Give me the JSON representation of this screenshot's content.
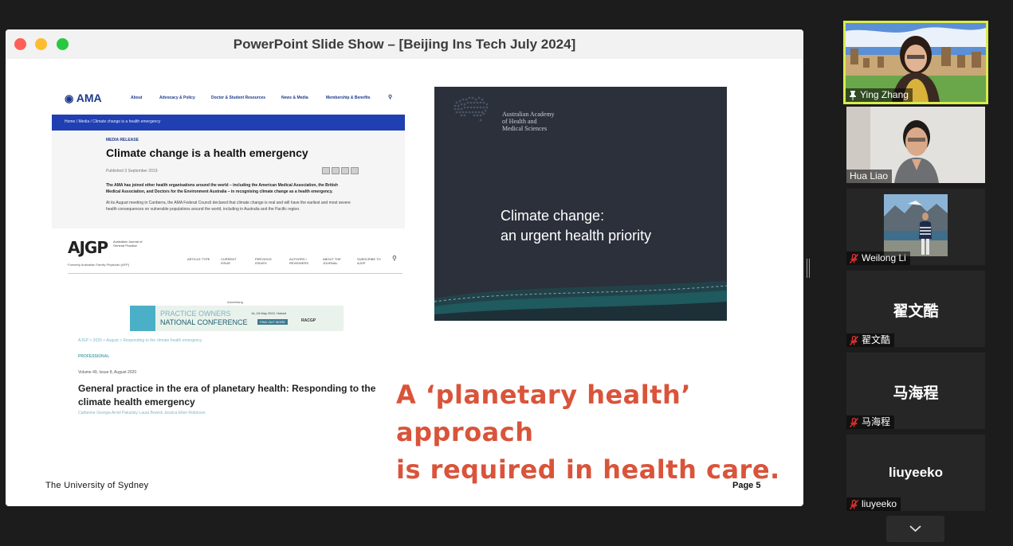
{
  "window": {
    "title": "PowerPoint Slide Show – [Beijing Ins Tech July 2024]",
    "traffic_colors": [
      "#fe5f57",
      "#febc2e",
      "#28c840"
    ]
  },
  "ama": {
    "logo": "AMA",
    "nav": [
      "About",
      "Advocacy & Policy",
      "Doctor & Student Resources",
      "News & Media",
      "Membership & Benefits"
    ],
    "breadcrumb": "Home  /  Media  /  Climate change is a health emergency",
    "label": "MEDIA RELEASE",
    "title": "Climate change is a health emergency",
    "date": "Published 3 September 2019",
    "body1": "The AMA has joined other health organisations around the world – including the American Medical Association, the British Medical Association, and Doctors for the Environment Australia – in recognising climate change as a health emergency.",
    "body2": "At its August meeting in Canberra, the AMA Federal Council declared that climate change is real and will have the earliest and most severe health consequences on vulnerable populations around the world, including in Australia and the Pacific region."
  },
  "ajgp": {
    "logo": "AJGP",
    "subtitle": "Australian Journal of General Practice",
    "formerly": "Formerly Australian Family Physician (AFP)",
    "nav": [
      "ARTICLE TYPE",
      "CURRENT ISSUE",
      "PREVIOUS ISSUES",
      "AUTHORS / REVIEWERS",
      "ABOUT THE JOURNAL",
      "SUBSCRIBE TO AJGP"
    ],
    "ad_label": "Advertising",
    "ad_line1": "PRACTICE OWNERS",
    "ad_line2": "NATIONAL CONFERENCE",
    "ad_date": "14–15 May 2022, Hobart",
    "ad_button": "FIND OUT MORE",
    "ad_brand": "RACGP",
    "breadcrumb": "AJGP > 2020 > August > Responding to the climate health emergency",
    "type": "PROFESSIONAL",
    "volume": "Volume 49, Issue 8, August 2020",
    "title": "General practice in the era of planetary health: Responding to the climate health emergency",
    "authors": "Catherine Georgia Arriol Pakulsky    Laura Bowick    Jessica Ellen Robinson"
  },
  "dark_slide": {
    "org": [
      "Australian Academy",
      "of Health and",
      "Medical Sciences"
    ],
    "title_line1": "Climate change:",
    "title_line2": "an urgent health priority"
  },
  "tagline": {
    "line1": "A ‘planetary health’ approach",
    "line2": "is required in health care."
  },
  "footer": {
    "left": "The University of Sydney",
    "right": "Page 5"
  },
  "participants": [
    {
      "name": "Ying Zhang",
      "type": "video",
      "pinned": true,
      "active_speaker": true,
      "muted": false
    },
    {
      "name": "Hua Liao",
      "type": "video",
      "pinned": false,
      "active_speaker": false,
      "muted": false
    },
    {
      "name": "Weilong Li",
      "type": "photo",
      "pinned": false,
      "active_speaker": false,
      "muted": true
    },
    {
      "name": "翟文酷",
      "type": "name",
      "pinned": false,
      "active_speaker": false,
      "muted": true
    },
    {
      "name": "马海程",
      "type": "name",
      "pinned": false,
      "active_speaker": false,
      "muted": true
    },
    {
      "name": "liuyeeko",
      "type": "name",
      "pinned": false,
      "active_speaker": false,
      "muted": true
    }
  ],
  "colors": {
    "active_speaker_border": "#d9ec4c",
    "tagline": "#d9543a",
    "ama_blue": "#1f3fb2",
    "muted_icon": "#e0312f"
  },
  "icons": {
    "pin": "pin-icon",
    "muted": "mic-muted-icon",
    "more": "chevron-down-icon"
  }
}
